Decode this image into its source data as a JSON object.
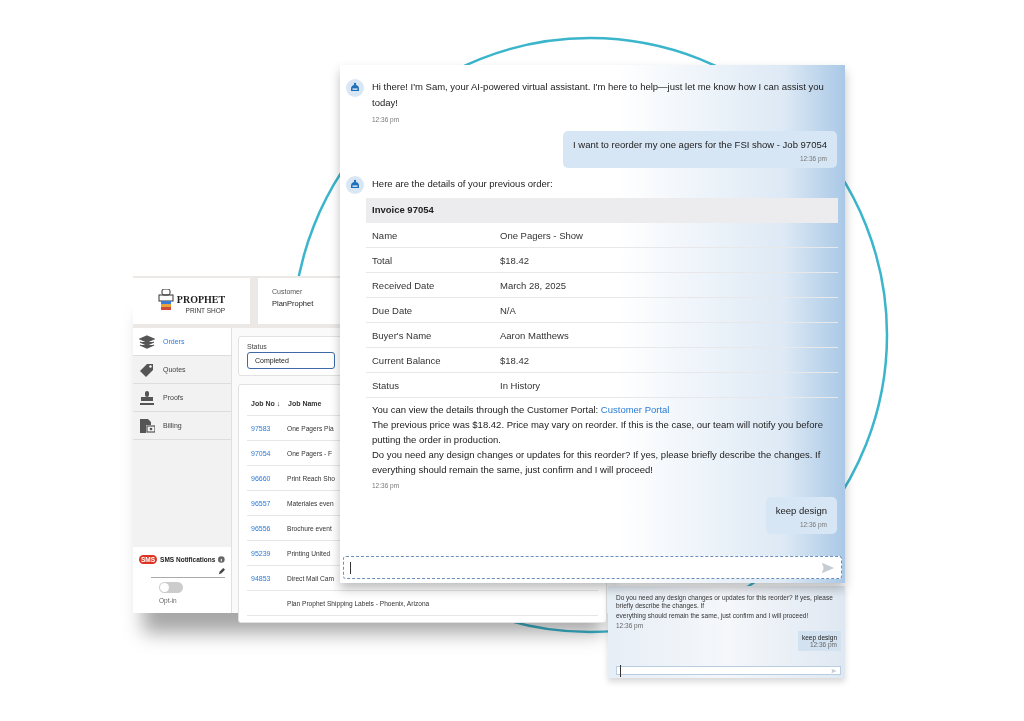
{
  "portal": {
    "logo": {
      "name": "PROPHET",
      "tagline": "PRINT SHOP"
    },
    "customer": {
      "label": "Customer",
      "value": "PlanProphet"
    },
    "sidebar": [
      {
        "label": "Orders",
        "selected": true
      },
      {
        "label": "Quotes",
        "selected": false
      },
      {
        "label": "Proofs",
        "selected": false
      },
      {
        "label": "Billing",
        "selected": false
      }
    ],
    "sms": {
      "title": "SMS Notifications",
      "badge": "SMS",
      "toggle_label": "Opt-in",
      "on": false
    },
    "status_filter": {
      "label": "Status",
      "value": "Completed"
    },
    "table": {
      "columns": [
        "Job No ↓",
        "Job Name"
      ],
      "rows": [
        {
          "job_no": "97583",
          "job_name": "One Pagers Pla"
        },
        {
          "job_no": "97054",
          "job_name": "One Pagers - F"
        },
        {
          "job_no": "96660",
          "job_name": "Print Reach Sho"
        },
        {
          "job_no": "96557",
          "job_name": "Materiales even"
        },
        {
          "job_no": "96556",
          "job_name": "Brochure event"
        },
        {
          "job_no": "95239",
          "job_name": "Printing United"
        },
        {
          "job_no": "94853",
          "job_name": "Direct Mail Cam"
        },
        {
          "job_no": "",
          "job_name": "Plan Prophet Shipping Labels - Phoenix, Arizona"
        }
      ]
    }
  },
  "chat": {
    "messages": [
      {
        "kind": "bot",
        "text": "Hi there! I'm Sam, your AI-powered virtual assistant. I'm here to help—just let me know how I can assist you today!",
        "time": "12:36 pm"
      },
      {
        "kind": "user",
        "text": "I want to reorder my one agers for the FSI show - Job 97054",
        "time": "12:36 pm"
      },
      {
        "kind": "details",
        "intro": "Here are the details of your previous order:",
        "invoice": "Invoice 97054",
        "rows": [
          {
            "label": "Name",
            "value": "One Pagers - Show"
          },
          {
            "label": "Total",
            "value": "$18.42"
          },
          {
            "label": "Received Date",
            "value": "March 28, 2025"
          },
          {
            "label": "Due Date",
            "value": "N/A"
          },
          {
            "label": "Buyer's Name",
            "value": "Aaron Matthews"
          },
          {
            "label": "Current Balance",
            "value": "$18.42"
          },
          {
            "label": "Status",
            "value": "In History"
          }
        ],
        "portal_text": "You can view the details through the Customer Portal:",
        "portal_link": "Customer Portal",
        "paragraphs": [
          "The previous price was $18.42. Price may vary on reorder. If this is the case, our team will notify you before putting the order in production.",
          "Do you need any design changes or updates for this reorder? If yes, please briefly describe the changes. If everything should remain the same, just confirm and I will proceed!"
        ],
        "time": "12:36 pm"
      },
      {
        "kind": "user",
        "text": "keep design",
        "time": "12:36 pm"
      }
    ]
  },
  "mini_chat": {
    "lines": [
      "Do you need any design changes or updates for this reorder? If yes, please briefly describe the changes. If",
      "everything should remain the same, just confirm and I will proceed!"
    ],
    "time": "12:36 pm",
    "reply": "keep design",
    "reply_time": "12:36 pm"
  }
}
